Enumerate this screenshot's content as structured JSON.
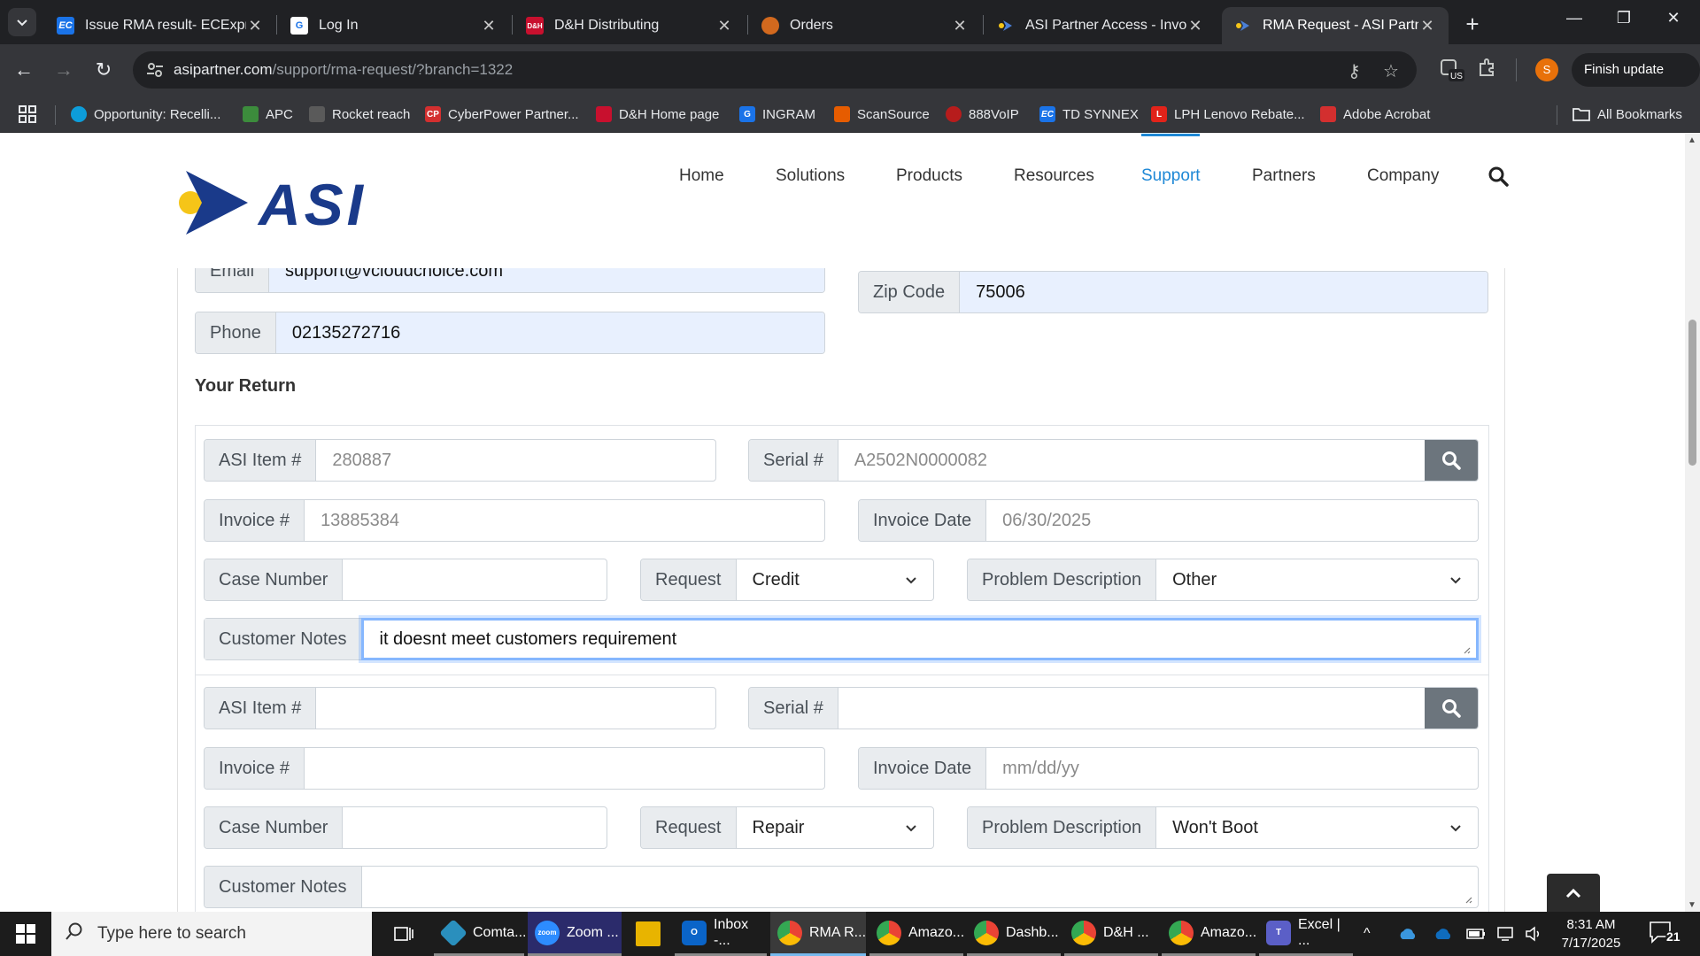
{
  "browser": {
    "tabs": [
      {
        "title": "Issue RMA result- ECExpre",
        "icon": "ec-icon",
        "icon_text": "EC",
        "icon_color": "#1a73e8"
      },
      {
        "title": "Log In",
        "icon": "login-icon",
        "icon_text": "G",
        "icon_color": "#1a73e8"
      },
      {
        "title": "D&H Distributing",
        "icon": "dh-icon",
        "icon_text": "D&H",
        "icon_color": "#c8102e"
      },
      {
        "title": "Orders",
        "icon": "orders-icon",
        "icon_text": "",
        "icon_color": "#d2691e"
      },
      {
        "title": "ASI Partner Access - Invoic",
        "icon": "asi-icon",
        "icon_text": "",
        "icon_color": "#1a3a8a"
      },
      {
        "title": "RMA Request - ASI Partner",
        "icon": "asi-icon",
        "icon_text": "",
        "icon_color": "#1a3a8a"
      }
    ],
    "new_tab": "+",
    "url_host": "asipartner.com",
    "url_path": "/support/rma-request/?branch=1322",
    "profile_initial": "S",
    "extension_badge": "US",
    "finish_update": "Finish update",
    "bookmarks": [
      {
        "label": "Opportunity: Recelli...",
        "icon_color": "#0d9dda",
        "icon_text": ""
      },
      {
        "label": "APC",
        "icon_color": "#3c8c3c",
        "icon_text": ""
      },
      {
        "label": "Rocket reach",
        "icon_color": "#5a5a5a",
        "icon_text": ""
      },
      {
        "label": "CyberPower Partner...",
        "icon_color": "#d32f2f",
        "icon_text": "CP"
      },
      {
        "label": "D&H Home page",
        "icon_color": "#c8102e",
        "icon_text": ""
      },
      {
        "label": "INGRAM",
        "icon_color": "#1a73e8",
        "icon_text": "G"
      },
      {
        "label": "ScanSource",
        "icon_color": "#e65c00",
        "icon_text": ""
      },
      {
        "label": "888VoIP",
        "icon_color": "#b71c1c",
        "icon_text": ""
      },
      {
        "label": "TD SYNNEX",
        "icon_color": "#1a73e8",
        "icon_text": "EC"
      },
      {
        "label": "LPH Lenovo Rebate...",
        "icon_color": "#e2231a",
        "icon_text": "L"
      },
      {
        "label": "Adobe Acrobat",
        "icon_color": "#d32f2f",
        "icon_text": ""
      }
    ],
    "all_bookmarks": "All Bookmarks"
  },
  "site": {
    "logo_text": "ASI",
    "brand_blue": "#1a3a8a",
    "brand_yellow": "#f5c518",
    "nav": [
      "Home",
      "Solutions",
      "Products",
      "Resources",
      "Support",
      "Partners",
      "Company"
    ],
    "active_nav": "Support"
  },
  "contact": {
    "email_label": "Email",
    "email_value": "support@vcloudchoice.com",
    "phone_label": "Phone",
    "phone_value": "02135272716",
    "zip_label": "Zip Code",
    "zip_value": "75006"
  },
  "return_section": {
    "title": "Your Return",
    "items": [
      {
        "asi_item_label": "ASI Item #",
        "asi_item_value": "280887",
        "serial_label": "Serial #",
        "serial_value": "A2502N0000082",
        "invoice_label": "Invoice #",
        "invoice_value": "13885384",
        "invoice_date_label": "Invoice Date",
        "invoice_date_value": "06/30/2025",
        "case_label": "Case Number",
        "case_value": "",
        "request_label": "Request",
        "request_value": "Credit",
        "problem_label": "Problem Description",
        "problem_value": "Other",
        "notes_label": "Customer Notes",
        "notes_value": "it doesnt meet customers requirement"
      },
      {
        "asi_item_label": "ASI Item #",
        "asi_item_value": "",
        "serial_label": "Serial #",
        "serial_value": "",
        "invoice_label": "Invoice #",
        "invoice_value": "",
        "invoice_date_label": "Invoice Date",
        "invoice_date_value": "mm/dd/yy",
        "case_label": "Case Number",
        "case_value": "",
        "request_label": "Request",
        "request_value": "Repair",
        "problem_label": "Problem Description",
        "problem_value": "Won't Boot",
        "notes_label": "Customer Notes",
        "notes_value": ""
      }
    ]
  },
  "taskbar": {
    "search_placeholder": "Type here to search",
    "apps": [
      {
        "label": "Comta...",
        "icon_color": "#2a8fbd",
        "icon_text": ""
      },
      {
        "label": "Zoom ...",
        "icon_color": "#2d8cff",
        "icon_text": "zoom"
      },
      {
        "label": "",
        "icon_color": "#e8b400",
        "icon_text": ""
      },
      {
        "label": "Inbox -...",
        "icon_color": "#0a64c8",
        "icon_text": "O"
      },
      {
        "label": "RMA R...",
        "icon_color": "#4285f4",
        "icon_text": ""
      },
      {
        "label": "Amazo...",
        "icon_color": "#4285f4",
        "icon_text": ""
      },
      {
        "label": "Dashb...",
        "icon_color": "#4285f4",
        "icon_text": ""
      },
      {
        "label": "D&H ...",
        "icon_color": "#4285f4",
        "icon_text": ""
      },
      {
        "label": "Amazo...",
        "icon_color": "#4285f4",
        "icon_text": ""
      },
      {
        "label": "Excel | ...",
        "icon_color": "#5b5fc7",
        "icon_text": "T"
      }
    ],
    "time": "8:31 AM",
    "date": "7/17/2025",
    "notification_count": "21"
  }
}
